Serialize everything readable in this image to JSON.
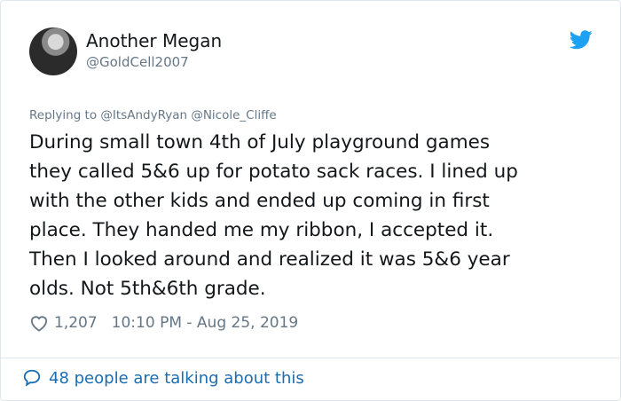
{
  "author": {
    "display_name": "Another Megan",
    "handle": "@GoldCell2007",
    "avatar_icon": "avatar-photo"
  },
  "brand": {
    "icon": "twitter-bird-icon",
    "color": "#1da1f2"
  },
  "reply": {
    "prefix": "Replying to",
    "users": [
      "@ItsAndyRyan",
      "@Nicole_Cliffe"
    ]
  },
  "tweet": {
    "lines": [
      "During small town 4th of July playground games",
      "they called 5&6 up for potato sack races. I lined up",
      "with the other kids and ended up coming in first",
      "place. They handed me my ribbon, I accepted it.",
      "Then I looked around and realized it was 5&6 year",
      "olds. Not 5th&6th grade."
    ]
  },
  "meta": {
    "likes": "1,207",
    "timestamp": "10:10 PM - Aug 25, 2019",
    "like_icon": "heart-icon"
  },
  "footer": {
    "talking_label": "48 people are talking about this",
    "icon": "speech-bubble-icon",
    "link_color": "#1b6db1"
  }
}
